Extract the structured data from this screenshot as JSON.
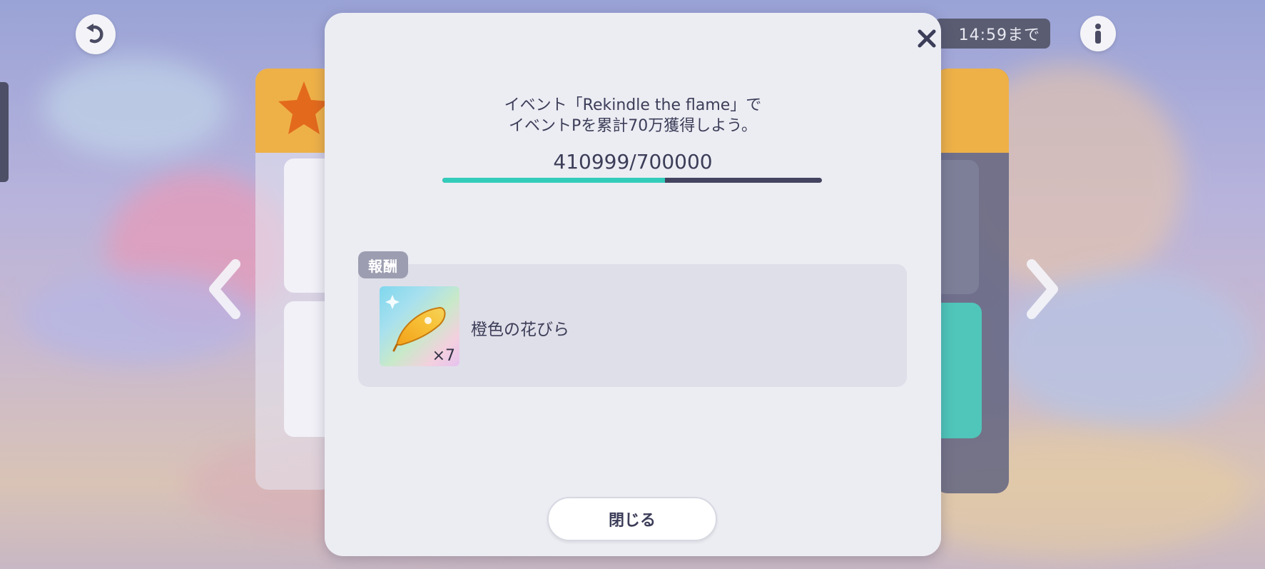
{
  "background": {
    "timer_text": "14:59まで"
  },
  "dialog": {
    "mission_line1": "イベント「Rekindle the flame」で",
    "mission_line2": "イベントPを累計70万獲得しよう。",
    "progress": {
      "text": "410999/700000",
      "current": 410999,
      "target": 700000
    },
    "reward_tag": "報酬",
    "reward_item": {
      "name": "橙色の花びら",
      "count": "×7"
    },
    "close_label": "閉じる"
  },
  "colors": {
    "progress_fill": "#33ccbb",
    "progress_track": "#444460",
    "dialog_bg": "#ecedf3",
    "text": "#3c3d58",
    "accent_orange": "#eeb148"
  },
  "icons": {
    "back": "back-arrow-icon",
    "info": "info-icon",
    "close": "close-icon",
    "prev": "chevron-left-icon",
    "next": "chevron-right-icon",
    "item": "orange-petal-icon"
  }
}
